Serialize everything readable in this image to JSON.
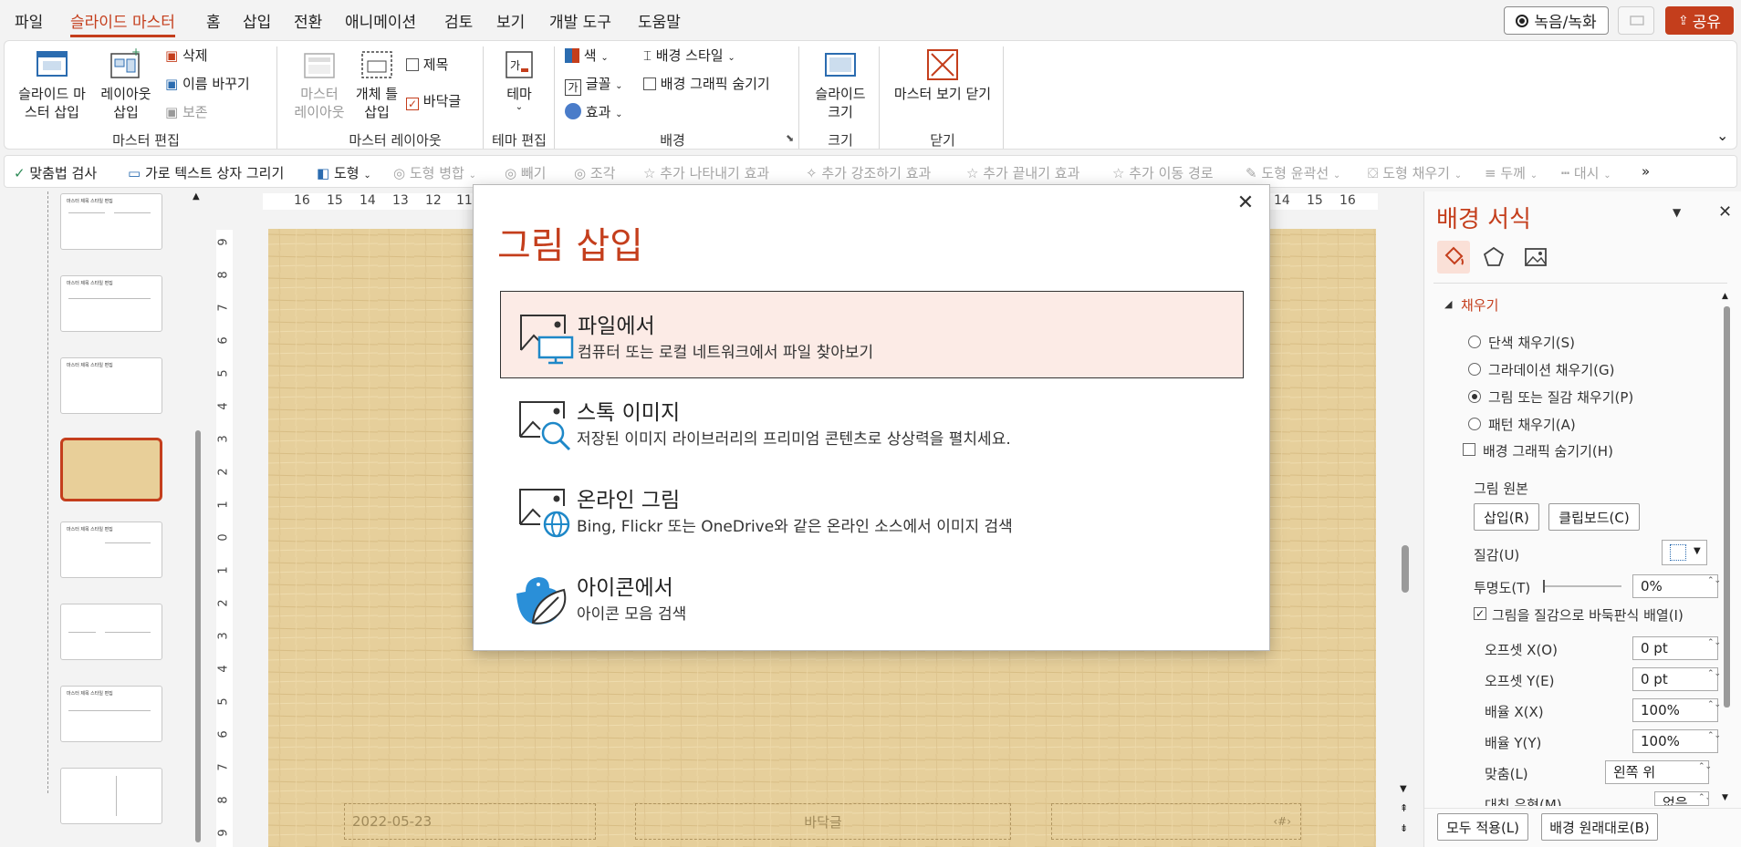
{
  "menubar": {
    "items": [
      "파일",
      "슬라이드 마스터",
      "홈",
      "삽입",
      "전환",
      "애니메이션",
      "검토",
      "보기",
      "개발 도구",
      "도움말"
    ],
    "record": "녹음/녹화",
    "share": "공유"
  },
  "ribbon": {
    "insert_slide_master": "슬라이드 마\n스터 삽입",
    "insert_layout": "레이아웃\n삽입",
    "delete": "삭제",
    "rename": "이름 바꾸기",
    "preserve": "보존",
    "master_layout": "마스터\n레이아웃",
    "insert_placeholder": "개체 틀\n삽입",
    "title_check": "제목",
    "footer_check": "바닥글",
    "theme": "테마",
    "colors": "색",
    "fonts": "글꼴",
    "effects": "효과",
    "bg_styles": "배경 스타일",
    "hide_bg_graphics": "배경 그래픽 숨기기",
    "slide_size": "슬라이드\n크기",
    "close_master": "마스터 보기 닫기",
    "groups": [
      "마스터 편집",
      "마스터 레이아웃",
      "테마 편집",
      "배경",
      "크기",
      "닫기"
    ]
  },
  "quickbar": {
    "items": [
      "맞춤법 검사",
      "가로 텍스트 상자 그리기",
      "도형",
      "도형 병합",
      "빼기",
      "조각",
      "추가 나타내기 효과",
      "추가 강조하기 효과",
      "추가 끝내기 효과",
      "추가 이동 경로",
      "도형 윤곽선",
      "도형 채우기",
      "두께",
      "대시"
    ]
  },
  "thumbnails": {
    "titles": [
      "마스터 제목 스타일 편집",
      "마스터 제목 스타일 편집",
      "마스터 제목 스타일 편집",
      "",
      "마스터 제목 스타일 편집",
      "",
      "마스터 제목 스타일 편집",
      ""
    ]
  },
  "ruler": {
    "h_ticks": [
      "16",
      "15",
      "14",
      "13",
      "12",
      "11",
      "14",
      "15",
      "16"
    ],
    "v_ticks": [
      "9",
      "8",
      "7",
      "6",
      "5",
      "4",
      "3",
      "2",
      "1",
      "0",
      "1",
      "2",
      "3",
      "4",
      "5",
      "6",
      "7",
      "8",
      "9"
    ]
  },
  "slide": {
    "date": "2022-05-23",
    "footer": "바닥글",
    "number": "‹#›"
  },
  "dialog": {
    "title": "그림 삽입",
    "options": [
      {
        "title": "파일에서",
        "desc": "컴퓨터 또는 로컬 네트워크에서 파일 찾아보기"
      },
      {
        "title": "스톡 이미지",
        "desc": "저장된 이미지 라이브러리의 프리미엄 콘텐츠로 상상력을 펼치세요."
      },
      {
        "title": "온라인 그림",
        "desc": "Bing, Flickr 또는 OneDrive와 같은 온라인 소스에서 이미지 검색"
      },
      {
        "title": "아이콘에서",
        "desc": "아이콘 모음 검색"
      }
    ]
  },
  "pane": {
    "title": "배경 서식",
    "section": "채우기",
    "radios": [
      "단색 채우기(S)",
      "그라데이션 채우기(G)",
      "그림 또는 질감 채우기(P)",
      "패턴 채우기(A)"
    ],
    "hide_bg": "배경 그래픽 숨기기(H)",
    "picture_source": "그림 원본",
    "insert_btn": "삽입(R)",
    "clipboard_btn": "클립보드(C)",
    "texture": "질감(U)",
    "transparency": "투명도(T)",
    "transparency_value": "0%",
    "tile": "그림을 질감으로 바둑판식 배열(I)",
    "offset_x": "오프셋 X(O)",
    "offset_x_value": "0 pt",
    "offset_y": "오프셋 Y(E)",
    "offset_y_value": "0 pt",
    "scale_x": "배율 X(X)",
    "scale_x_value": "100%",
    "scale_y": "배율 Y(Y)",
    "scale_y_value": "100%",
    "align": "맞춤(L)",
    "align_value": "왼쪽 위",
    "mirror": "대칭 유형(M)",
    "mirror_value": "없음",
    "apply_all": "모두 적용(L)",
    "reset_bg": "배경 원래대로(B)"
  },
  "colors": {
    "accent": "#c43e1c",
    "slide_bg": "#e6cf9b"
  }
}
